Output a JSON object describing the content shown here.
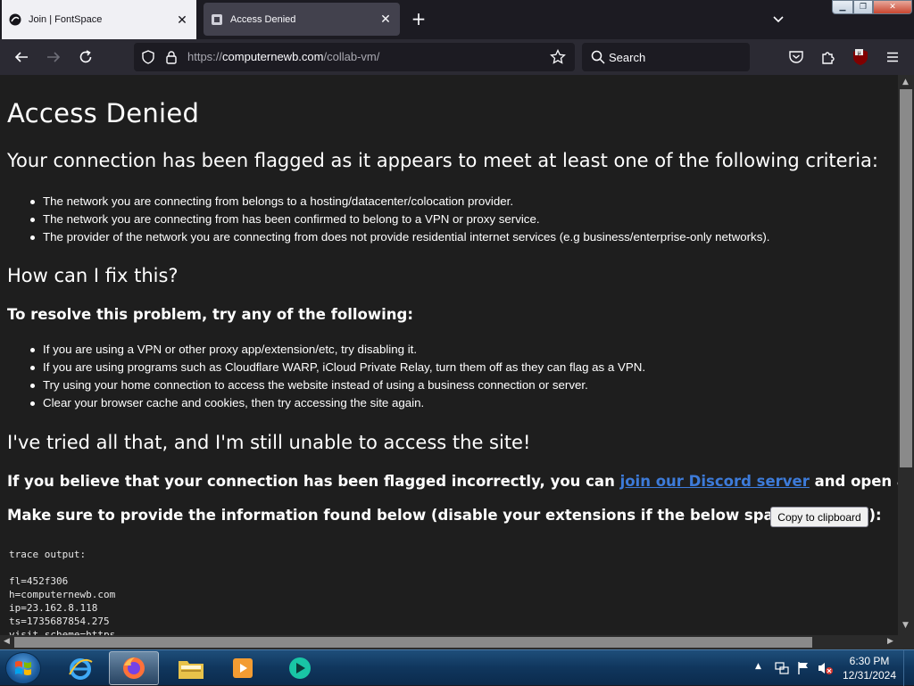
{
  "browser": {
    "tabs": [
      {
        "label": "Join | FontSpace",
        "active": false
      },
      {
        "label": "Access Denied",
        "active": true
      }
    ],
    "url": {
      "scheme": "https://",
      "host": "computernewb.com",
      "path": "/collab-vm/"
    },
    "search_placeholder": "Search"
  },
  "page": {
    "title": "Access Denied",
    "flagged_heading": "Your connection has been flagged as it appears to meet at least one of the following criteria:",
    "criteria": [
      "The network you are connecting from belongs to a hosting/datacenter/colocation provider.",
      "The network you are connecting from has been confirmed to belong to a VPN or proxy service.",
      "The provider of the network you are connecting from does not provide residential internet services (e.g business/enterprise-only networks)."
    ],
    "fix_heading": "How can I fix this?",
    "resolve_intro": "To resolve this problem, try any of the following:",
    "fixes": [
      "If you are using a VPN or other proxy app/extension/etc, try disabling it.",
      "If you are using programs such as Cloudflare WARP, iCloud Private Relay, turn them off as they can flag as a VPN.",
      "Try using your home connection to access the website instead of using a business connection or server.",
      "Clear your browser cache and cookies, then try accessing the site again."
    ],
    "tried_heading": "I've tried all that, and I'm still unable to access the site!",
    "believe_prefix": "If you believe that your connection has been flagged incorrectly, you can ",
    "discord_link": "join our Discord server",
    "believe_suffix": " and open a ticket.",
    "provide_info": "Make sure to provide the information found below (disable your extensions if the below space is empty):",
    "copy_button": "Copy to clipboard",
    "trace": "trace output:\n\nfl=452f306\nh=computernewb.com\nip=23.162.8.118\nts=1735687854.275\nvisit_scheme=https"
  },
  "taskbar": {
    "time": "6:30 PM",
    "date": "12/31/2024"
  }
}
